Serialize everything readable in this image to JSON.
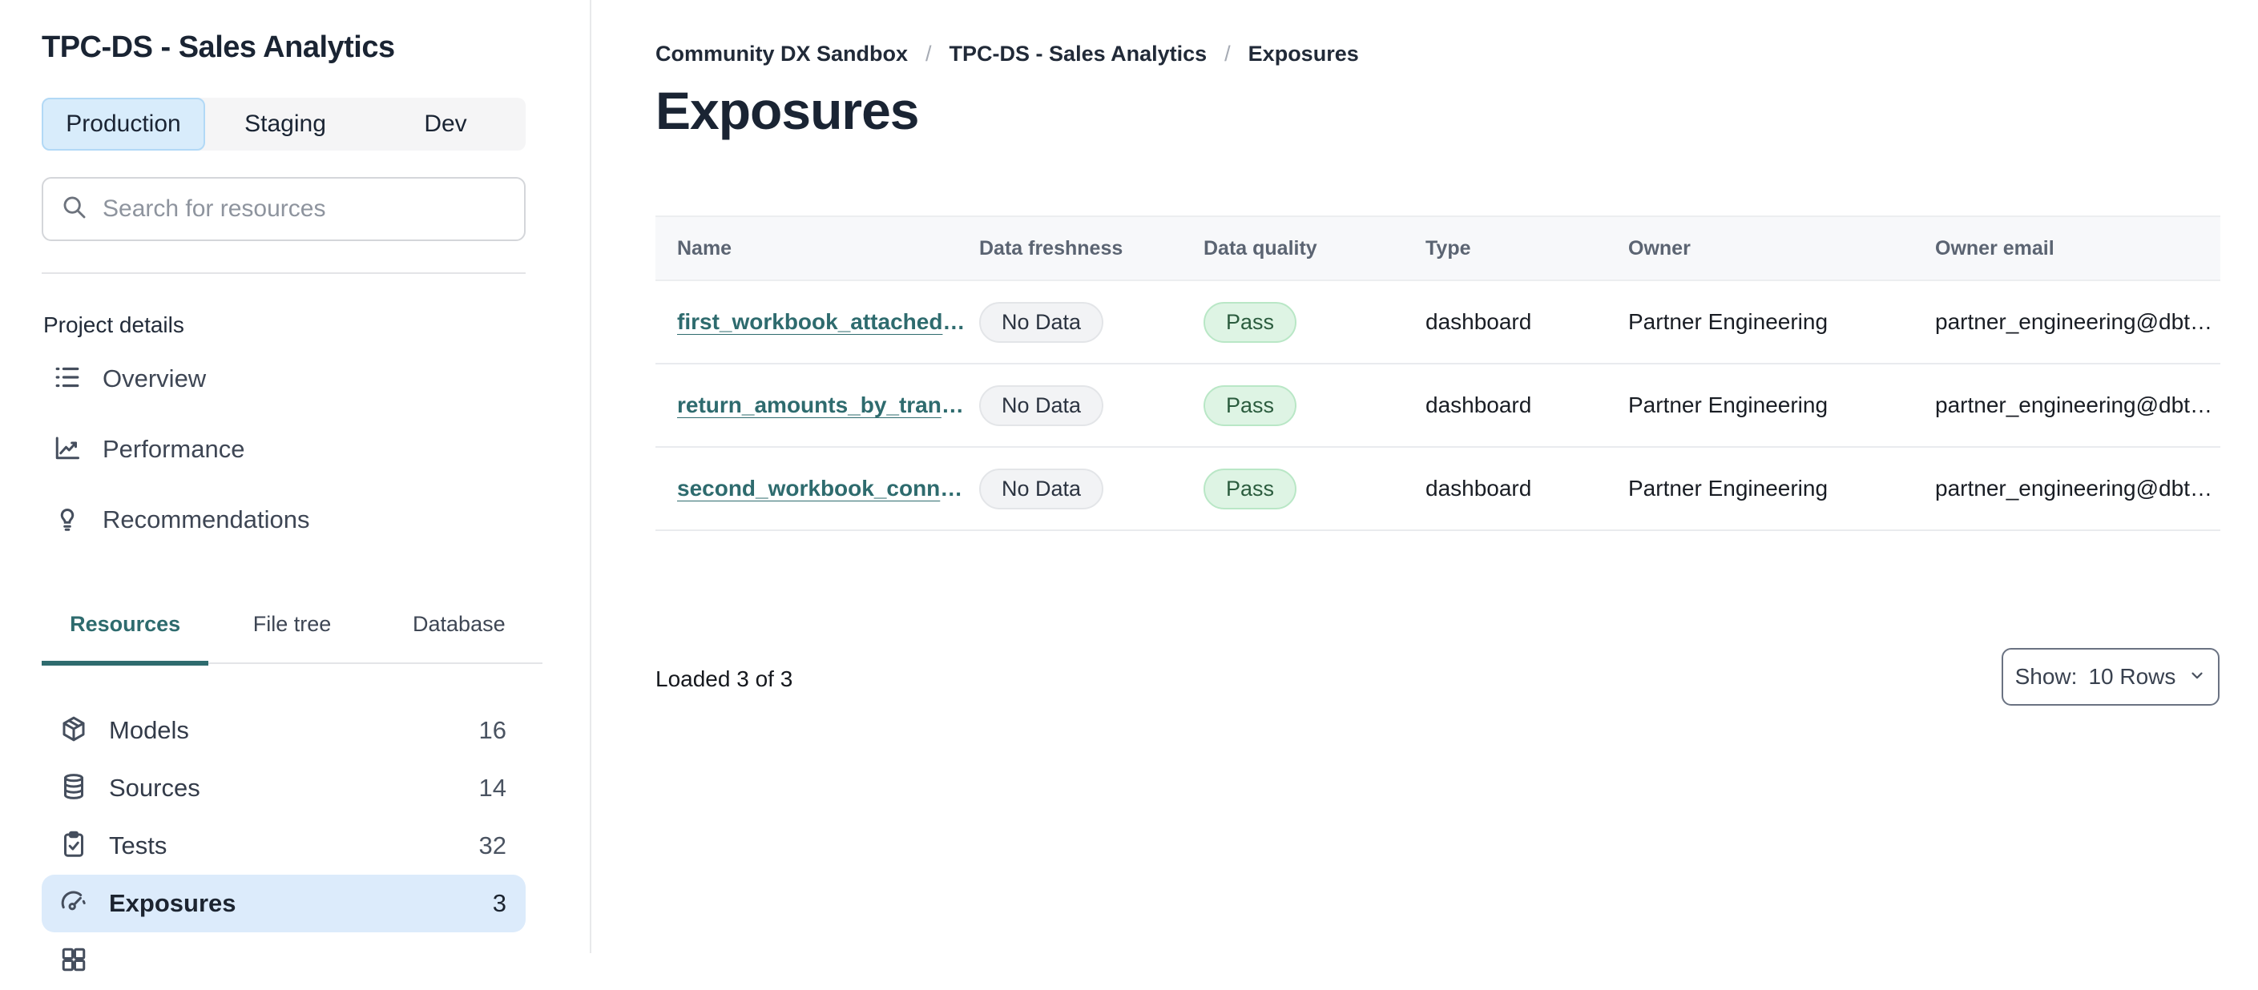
{
  "sidebar": {
    "project_title": "TPC-DS - Sales Analytics",
    "env_tabs": [
      {
        "label": "Production",
        "active": true
      },
      {
        "label": "Staging",
        "active": false
      },
      {
        "label": "Dev",
        "active": false
      }
    ],
    "search": {
      "placeholder": "Search for resources"
    },
    "section_label": "Project details",
    "nav": [
      {
        "label": "Overview",
        "icon": "list-icon"
      },
      {
        "label": "Performance",
        "icon": "chart-line-icon"
      },
      {
        "label": "Recommendations",
        "icon": "lightbulb-icon"
      }
    ],
    "resource_tabs": [
      {
        "label": "Resources",
        "active": true
      },
      {
        "label": "File tree",
        "active": false
      },
      {
        "label": "Database",
        "active": false
      }
    ],
    "resources": [
      {
        "label": "Models",
        "count": "16",
        "icon": "cube-icon",
        "selected": false
      },
      {
        "label": "Sources",
        "count": "14",
        "icon": "database-icon",
        "selected": false
      },
      {
        "label": "Tests",
        "count": "32",
        "icon": "clipboard-check-icon",
        "selected": false
      },
      {
        "label": "Exposures",
        "count": "3",
        "icon": "gauge-icon",
        "selected": true
      }
    ]
  },
  "main": {
    "breadcrumb": {
      "items": [
        "Community DX Sandbox",
        "TPC-DS - Sales Analytics",
        "Exposures"
      ],
      "separator": "/"
    },
    "page_title": "Exposures",
    "table": {
      "columns": [
        "Name",
        "Data freshness",
        "Data quality",
        "Type",
        "Owner",
        "Owner email"
      ],
      "truncation": "…",
      "rows": [
        {
          "name": "first_workbook_attached",
          "freshness": "No Data",
          "quality": "Pass",
          "type": "dashboard",
          "owner": "Partner Engineering",
          "owner_email": "partner_engineering@dbt…"
        },
        {
          "name": "return_amounts_by_tran",
          "freshness": "No Data",
          "quality": "Pass",
          "type": "dashboard",
          "owner": "Partner Engineering",
          "owner_email": "partner_engineering@dbt…"
        },
        {
          "name": "second_workbook_conn",
          "freshness": "No Data",
          "quality": "Pass",
          "type": "dashboard",
          "owner": "Partner Engineering",
          "owner_email": "partner_engineering@dbt…"
        }
      ]
    },
    "status_text": "Loaded 3 of 3",
    "pagination": {
      "label": "Show:",
      "value": "10 Rows"
    }
  },
  "colors": {
    "accent_teal": "#2e6b6e",
    "selected_row_blue": "#dcebfb",
    "active_env_tab_blue": "#d8ecfb",
    "pass_badge_bg": "#def4e4",
    "pass_badge_text": "#2b5c3e",
    "no_data_badge_bg": "#f2f3f5",
    "header_bg": "#f7f8fa"
  }
}
